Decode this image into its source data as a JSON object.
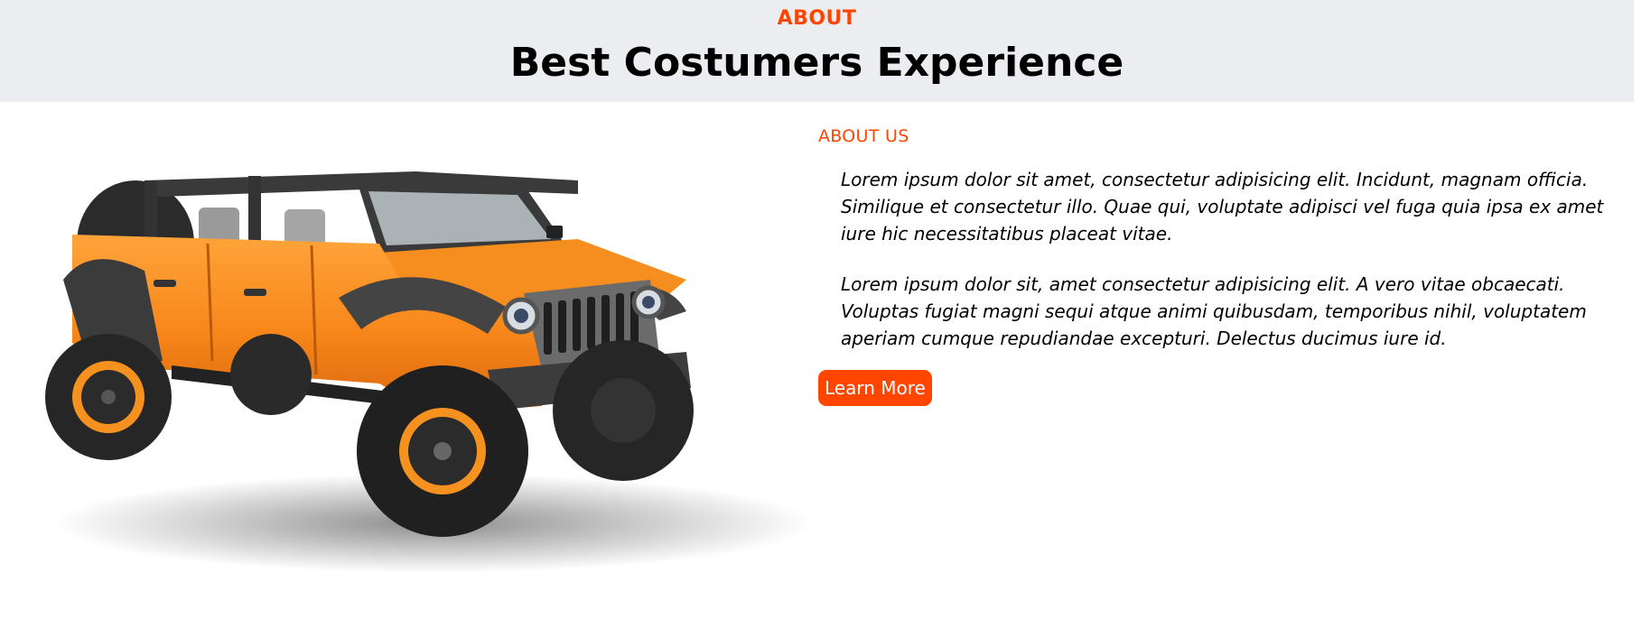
{
  "section": {
    "eyebrow": "ABOUT",
    "title": "Best Costumers Experience"
  },
  "about": {
    "label": "ABOUT US",
    "paragraphs": [
      "Lorem ipsum dolor sit amet, consectetur adipisicing elit. Incidunt, magnam officia. Similique et consectetur illo. Quae qui, voluptate adipisci vel fuga quia ipsa ex amet iure hic necessitatibus placeat vitae.",
      "Lorem ipsum dolor sit, amet consectetur adipisicing elit. A vero vitae obcaecati. Voluptas fugiat magni sequi atque animi quibusdam, temporibus nihil, voluptatem aperiam cumque repudiandae excepturi. Delectus ducimus iure id."
    ],
    "button_label": "Learn More"
  },
  "image": {
    "subject": "orange-jeep-photo"
  },
  "colors": {
    "accent": "#ff4500",
    "header_bg": "#ecedf0",
    "jeep_body": "#f7921e"
  }
}
